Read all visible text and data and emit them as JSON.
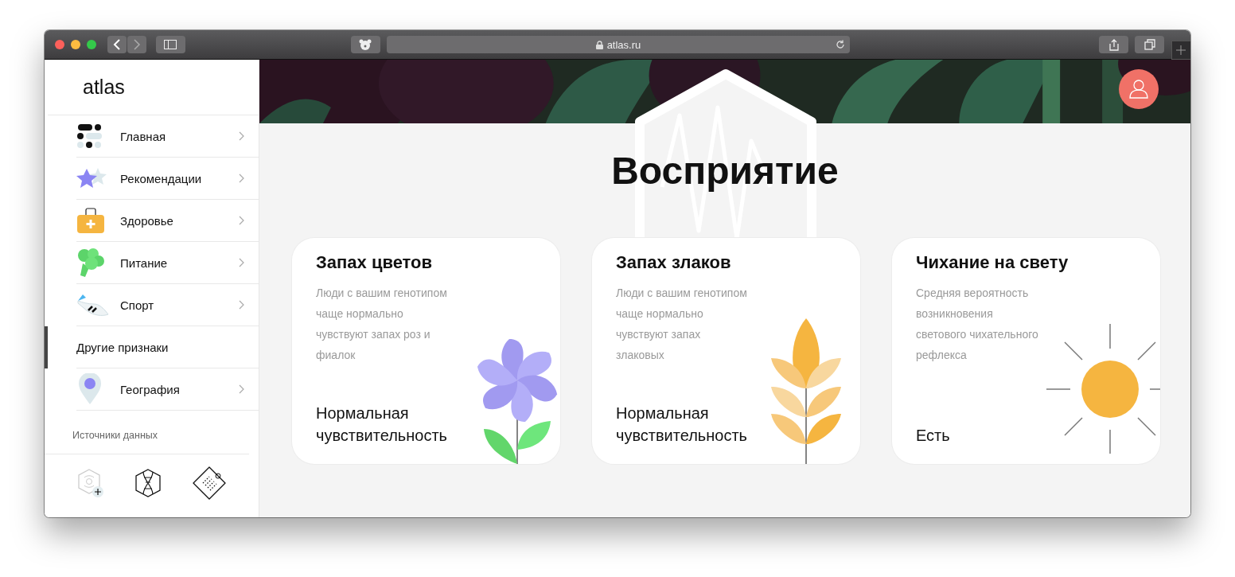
{
  "browser": {
    "url": "atlas.ru"
  },
  "sidebar": {
    "logo": "atlas",
    "items": [
      {
        "label": "Главная",
        "kind": "dots",
        "selected": false
      },
      {
        "label": "Рекомендации",
        "kind": "stars",
        "selected": false
      },
      {
        "label": "Здоровье",
        "kind": "kit",
        "selected": false
      },
      {
        "label": "Питание",
        "kind": "broccoli",
        "selected": false
      },
      {
        "label": "Спорт",
        "kind": "sneaker",
        "selected": false
      },
      {
        "label": "Другие признаки",
        "kind": "plain",
        "selected": true
      },
      {
        "label": "География",
        "kind": "pin",
        "selected": false
      }
    ],
    "sources_label": "Источники данных"
  },
  "page": {
    "title": "Восприятие",
    "cards": [
      {
        "title": "Запах цветов",
        "description": [
          "Люди с вашим генотипом",
          "чаще нормально",
          "чувствуют запах роз и",
          "фиалок"
        ],
        "result": "Нормальная чувствительность",
        "kind": "flower"
      },
      {
        "title": "Запах злаков",
        "description": [
          "Люди с вашим генотипом",
          "чаще нормально",
          "чувствуют запах",
          "злаковых"
        ],
        "result": "Нормальная чувствительность",
        "kind": "wheat"
      },
      {
        "title": "Чихание на свету",
        "description": [
          "Средняя вероятность",
          "возникновения",
          "светового чихательного",
          "рефлекса"
        ],
        "result": "Есть",
        "kind": "sun"
      }
    ]
  }
}
